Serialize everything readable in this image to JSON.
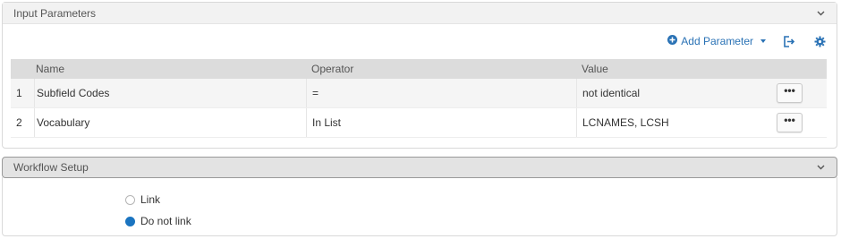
{
  "input_section": {
    "title": "Input Parameters"
  },
  "toolbar": {
    "add_parameter_label": "Add Parameter"
  },
  "table": {
    "headers": {
      "name": "Name",
      "operator": "Operator",
      "value": "Value"
    },
    "rows": [
      {
        "num": "1",
        "name": "Subfield Codes",
        "operator": "=",
        "value": "not identical",
        "action": "•••"
      },
      {
        "num": "2",
        "name": "Vocabulary",
        "operator": "In List",
        "value": "LCNAMES, LCSH",
        "action": "•••"
      }
    ]
  },
  "workflow_section": {
    "title": "Workflow Setup",
    "options": [
      {
        "label": "Link",
        "selected": false
      },
      {
        "label": "Do not link",
        "selected": true
      }
    ]
  },
  "colors": {
    "accent": "#2a72b5",
    "radio_selected": "#1b74c0"
  }
}
